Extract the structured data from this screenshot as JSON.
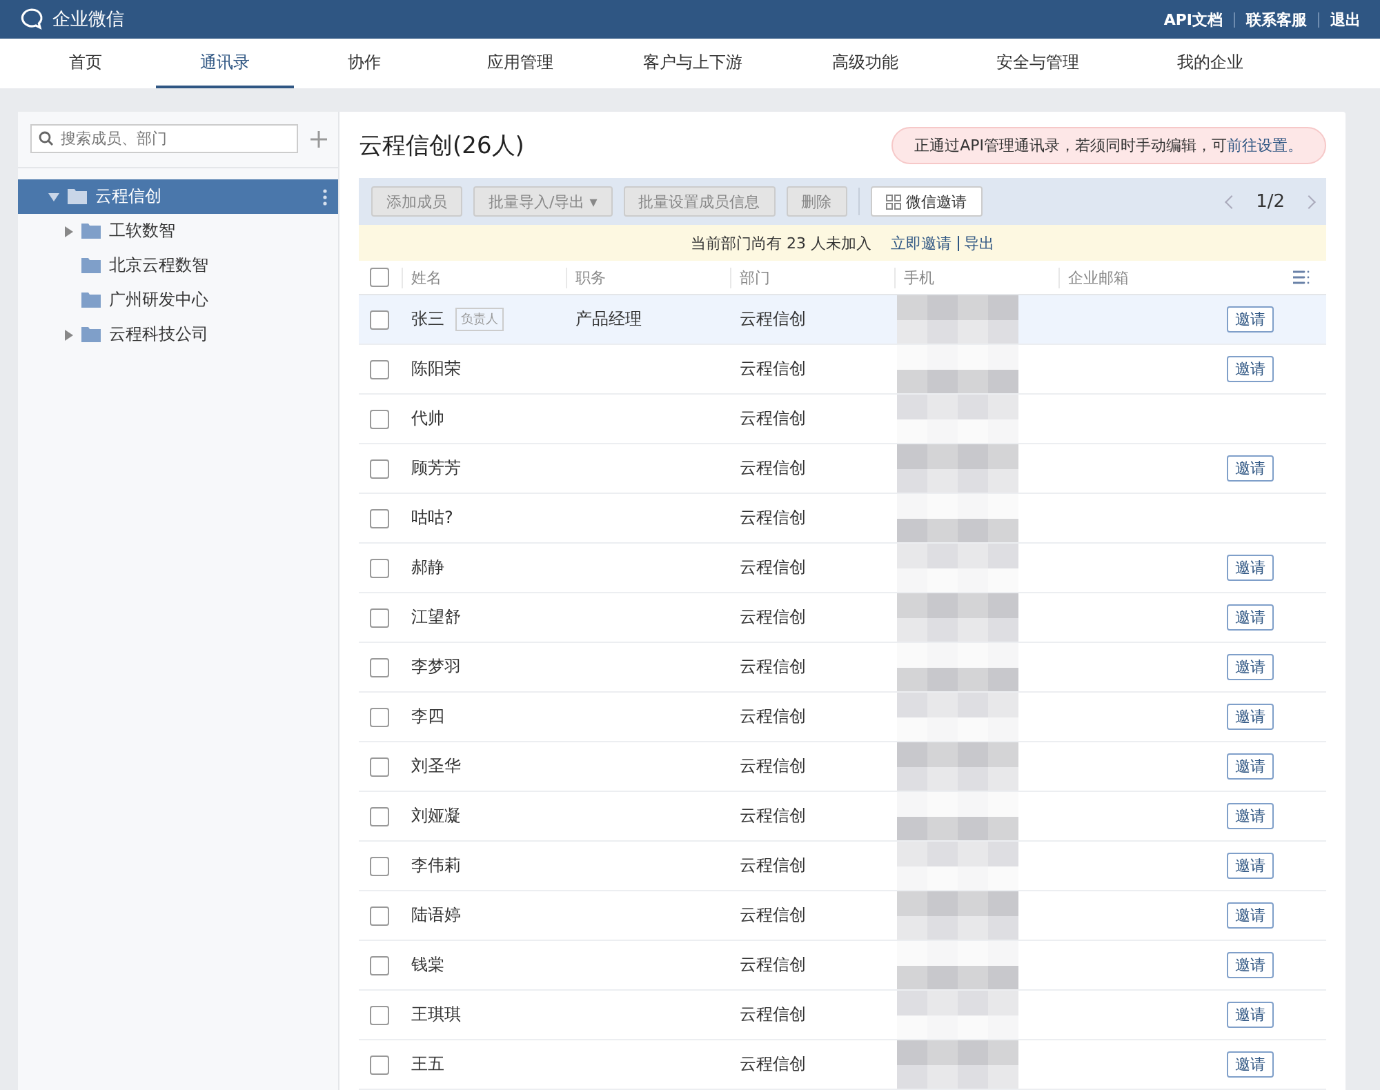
{
  "header": {
    "logo": "企业微信",
    "links": [
      "API文档",
      "联系客服",
      "退出"
    ]
  },
  "nav": [
    {
      "label": "首页",
      "selected": false
    },
    {
      "label": "通讯录",
      "selected": true
    },
    {
      "label": "协作",
      "selected": false
    },
    {
      "label": "应用管理",
      "selected": false
    },
    {
      "label": "客户与上下游",
      "selected": false
    },
    {
      "label": "高级功能",
      "selected": false
    },
    {
      "label": "安全与管理",
      "selected": false
    },
    {
      "label": "我的企业",
      "selected": false
    }
  ],
  "sidebar": {
    "search": {
      "placeholder": "搜索成员、部门"
    },
    "tree": [
      {
        "label": "云程信创",
        "selected": true,
        "expandable": true,
        "expanded": true,
        "children": [
          {
            "label": "工软数智",
            "selected": false,
            "expandable": true,
            "expanded": false
          },
          {
            "label": "北京云程数智",
            "selected": false,
            "expandable": false
          },
          {
            "label": "广州研发中心",
            "selected": false,
            "expandable": false
          },
          {
            "label": "云程科技公司",
            "selected": false,
            "expandable": true,
            "expanded": false
          }
        ]
      }
    ]
  },
  "main": {
    "title": "云程信创(26人)",
    "notice": {
      "text": "正通过API管理通讯录，若须同时手动编辑，可",
      "link": "前往设置。"
    },
    "toolbar": [
      {
        "label": "添加成员",
        "kind": "disabled"
      },
      {
        "label": "批量导入/导出 ▾",
        "kind": "disabled"
      },
      {
        "label": "批量设置成员信息",
        "kind": "disabled"
      },
      {
        "label": "删除",
        "kind": "disabled"
      },
      {
        "label": "微信邀请",
        "kind": "qr"
      }
    ],
    "pager": "1/2",
    "banner": {
      "text": "当前部门尚有 23 人未加入",
      "links": [
        "立即邀请",
        "导出"
      ]
    },
    "table": {
      "select_all_checked": false,
      "columns": [
        "姓名",
        "职务",
        "部门",
        "手机",
        "企业邮箱"
      ],
      "rows": [
        {
          "name": "张三",
          "badge": "负责人",
          "title": "产品经理",
          "dept": "云程信创",
          "invite": "邀请",
          "checked": false,
          "highlighted": true
        },
        {
          "name": "陈阳荣",
          "dept": "云程信创",
          "invite": "邀请",
          "checked": false,
          "highlighted": false
        },
        {
          "name": "代帅",
          "dept": "云程信创",
          "checked": false,
          "highlighted": false
        },
        {
          "name": "顾芳芳",
          "dept": "云程信创",
          "invite": "邀请",
          "checked": false,
          "highlighted": false
        },
        {
          "name": "咕咕?",
          "dept": "云程信创",
          "checked": false,
          "highlighted": false
        },
        {
          "name": "郝静",
          "dept": "云程信创",
          "invite": "邀请",
          "checked": false,
          "highlighted": false
        },
        {
          "name": "江望舒",
          "dept": "云程信创",
          "invite": "邀请",
          "checked": false,
          "highlighted": false
        },
        {
          "name": "李梦羽",
          "dept": "云程信创",
          "invite": "邀请",
          "checked": false,
          "highlighted": false
        },
        {
          "name": "李四",
          "dept": "云程信创",
          "invite": "邀请",
          "checked": false,
          "highlighted": false
        },
        {
          "name": "刘圣华",
          "dept": "云程信创",
          "invite": "邀请",
          "checked": false,
          "highlighted": false
        },
        {
          "name": "刘娅凝",
          "dept": "云程信创",
          "invite": "邀请",
          "checked": false,
          "highlighted": false
        },
        {
          "name": "李伟莉",
          "dept": "云程信创",
          "invite": "邀请",
          "checked": false,
          "highlighted": false
        },
        {
          "name": "陆语婷",
          "dept": "云程信创",
          "invite": "邀请",
          "checked": false,
          "highlighted": false
        },
        {
          "name": "钱棠",
          "dept": "云程信创",
          "invite": "邀请",
          "checked": false,
          "highlighted": false
        },
        {
          "name": "王琪琪",
          "dept": "云程信创",
          "invite": "邀请",
          "checked": false,
          "highlighted": false
        },
        {
          "name": "王五",
          "dept": "云程信创",
          "invite": "邀请",
          "checked": false,
          "highlighted": false
        }
      ]
    }
  }
}
